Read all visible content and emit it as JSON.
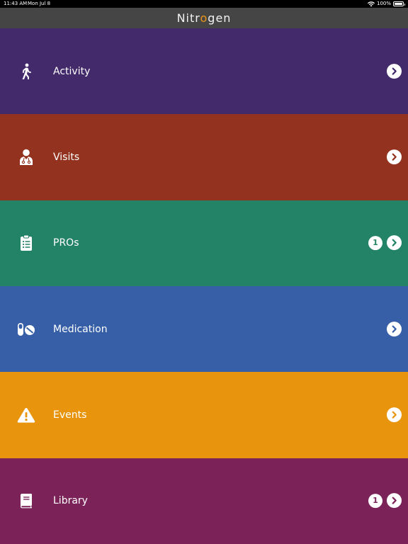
{
  "status_bar": {
    "time": "11:43 AM",
    "date": "Mon Jul 8",
    "battery": "100%",
    "battery_level": 1.0
  },
  "header": {
    "title_part1": "Nitr",
    "title_accent": "o",
    "title_part2": "gen",
    "bar_color": "#454545",
    "accent_color": "#e8941a"
  },
  "menu": {
    "items": [
      {
        "label": "Activity",
        "icon": "walking-person-icon",
        "color": "#432a6b",
        "badge": ""
      },
      {
        "label": "Visits",
        "icon": "doctor-icon",
        "color": "#93331f",
        "badge": ""
      },
      {
        "label": "PROs",
        "icon": "clipboard-list-icon",
        "color": "#238367",
        "badge": "1"
      },
      {
        "label": "Medication",
        "icon": "pills-icon",
        "color": "#365fa8",
        "badge": ""
      },
      {
        "label": "Events",
        "icon": "warning-icon",
        "color": "#e8940d",
        "badge": ""
      },
      {
        "label": "Library",
        "icon": "book-icon",
        "color": "#7b2258",
        "badge": "1"
      }
    ]
  }
}
